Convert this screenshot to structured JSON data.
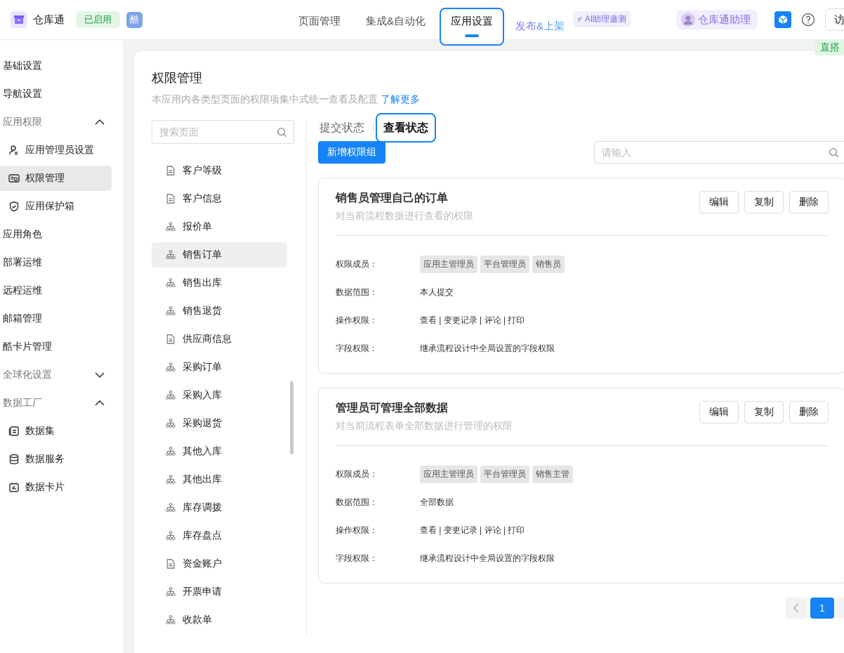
{
  "header": {
    "app_name": "仓库通",
    "status_badge": "已启用",
    "app_badge": "酷",
    "nav": [
      {
        "label": "页面管理",
        "selected": false
      },
      {
        "label": "集成&自动化",
        "selected": false
      },
      {
        "label": "应用设置",
        "selected": true
      },
      {
        "label": "发布&上架",
        "selected": false
      }
    ],
    "ai_badge": "AI助理邀测",
    "assistant": "仓库通助理",
    "visit_button": "访",
    "side_badge": "直搭"
  },
  "sidebar": [
    {
      "label": "基础设置",
      "selected": false
    },
    {
      "label": "导航设置",
      "selected": false
    },
    {
      "label": "应用权限",
      "expanded": true,
      "children": [
        {
          "label": "应用管理员设置",
          "selected": false
        },
        {
          "label": "权限管理",
          "selected": true
        },
        {
          "label": "应用保护箱",
          "selected": false
        }
      ]
    },
    {
      "label": "应用角色",
      "selected": false
    },
    {
      "label": "部署运维",
      "selected": false
    },
    {
      "label": "远程运维",
      "selected": false
    },
    {
      "label": "邮箱管理",
      "selected": false
    },
    {
      "label": "酷卡片管理",
      "selected": false
    },
    {
      "label": "全球化设置",
      "expanded": false
    },
    {
      "label": "数据工厂",
      "expanded": true,
      "children": [
        {
          "label": "数据集",
          "selected": false
        },
        {
          "label": "数据服务",
          "selected": false
        },
        {
          "label": "数据卡片",
          "selected": false
        }
      ]
    }
  ],
  "page": {
    "title": "权限管理",
    "description": "本应用内各类型页面的权限项集中式统一查看及配置",
    "learn_more": "了解更多"
  },
  "page_search": {
    "placeholder": "搜索页面"
  },
  "pages": [
    {
      "label": "客户等级",
      "kind": "form",
      "selected": false
    },
    {
      "label": "客户信息",
      "kind": "form",
      "selected": false
    },
    {
      "label": "报价单",
      "kind": "flow",
      "selected": false
    },
    {
      "label": "销售订单",
      "kind": "flow",
      "selected": true
    },
    {
      "label": "销售出库",
      "kind": "flow",
      "selected": false
    },
    {
      "label": "销售退货",
      "kind": "flow",
      "selected": false
    },
    {
      "label": "供应商信息",
      "kind": "form",
      "selected": false
    },
    {
      "label": "采购订单",
      "kind": "flow",
      "selected": false
    },
    {
      "label": "采购入库",
      "kind": "flow",
      "selected": false
    },
    {
      "label": "采购退货",
      "kind": "flow",
      "selected": false
    },
    {
      "label": "其他入库",
      "kind": "flow",
      "selected": false
    },
    {
      "label": "其他出库",
      "kind": "flow",
      "selected": false
    },
    {
      "label": "库存调拨",
      "kind": "flow",
      "selected": false
    },
    {
      "label": "库存盘点",
      "kind": "flow",
      "selected": false
    },
    {
      "label": "资金账户",
      "kind": "form",
      "selected": false
    },
    {
      "label": "开票申请",
      "kind": "flow",
      "selected": false
    },
    {
      "label": "收款单",
      "kind": "flow",
      "selected": false
    }
  ],
  "status_tabs": [
    {
      "label": "提交状态",
      "selected": false
    },
    {
      "label": "查看状态",
      "selected": true
    }
  ],
  "add_button": "新增权限组",
  "group_search": {
    "placeholder": "请输入"
  },
  "groups": [
    {
      "title": "销售员管理自己的订单",
      "description": "对当前流程数据进行查看的权限",
      "buttons": [
        "编辑",
        "复制",
        "删除"
      ],
      "fields": [
        {
          "label": "权限成员：",
          "kind": "tags",
          "tags": [
            "应用主管理员",
            "平台管理员",
            "销售员"
          ]
        },
        {
          "label": "数据范围：",
          "kind": "text",
          "value": "本人提交"
        },
        {
          "label": "操作权限：",
          "kind": "text",
          "value": "查看 | 变更记录 | 评论 | 打印"
        },
        {
          "label": "字段权限：",
          "kind": "text",
          "value": "继承流程设计中全局设置的字段权限"
        }
      ]
    },
    {
      "title": "管理员可管理全部数据",
      "description": "对当前流程表单全部数据进行管理的权限",
      "buttons": [
        "编辑",
        "复制",
        "删除"
      ],
      "fields": [
        {
          "label": "权限成员：",
          "kind": "tags",
          "tags": [
            "应用主管理员",
            "平台管理员",
            "销售主管"
          ]
        },
        {
          "label": "数据范围：",
          "kind": "text",
          "value": "全部数据"
        },
        {
          "label": "操作权限：",
          "kind": "text",
          "value": "查看 | 变更记录 | 评论 | 打印"
        },
        {
          "label": "字段权限：",
          "kind": "text",
          "value": "继承流程设计中全局设置的字段权限"
        }
      ]
    }
  ],
  "pagination": {
    "pages": [
      {
        "label": "1",
        "selected": true
      }
    ]
  }
}
